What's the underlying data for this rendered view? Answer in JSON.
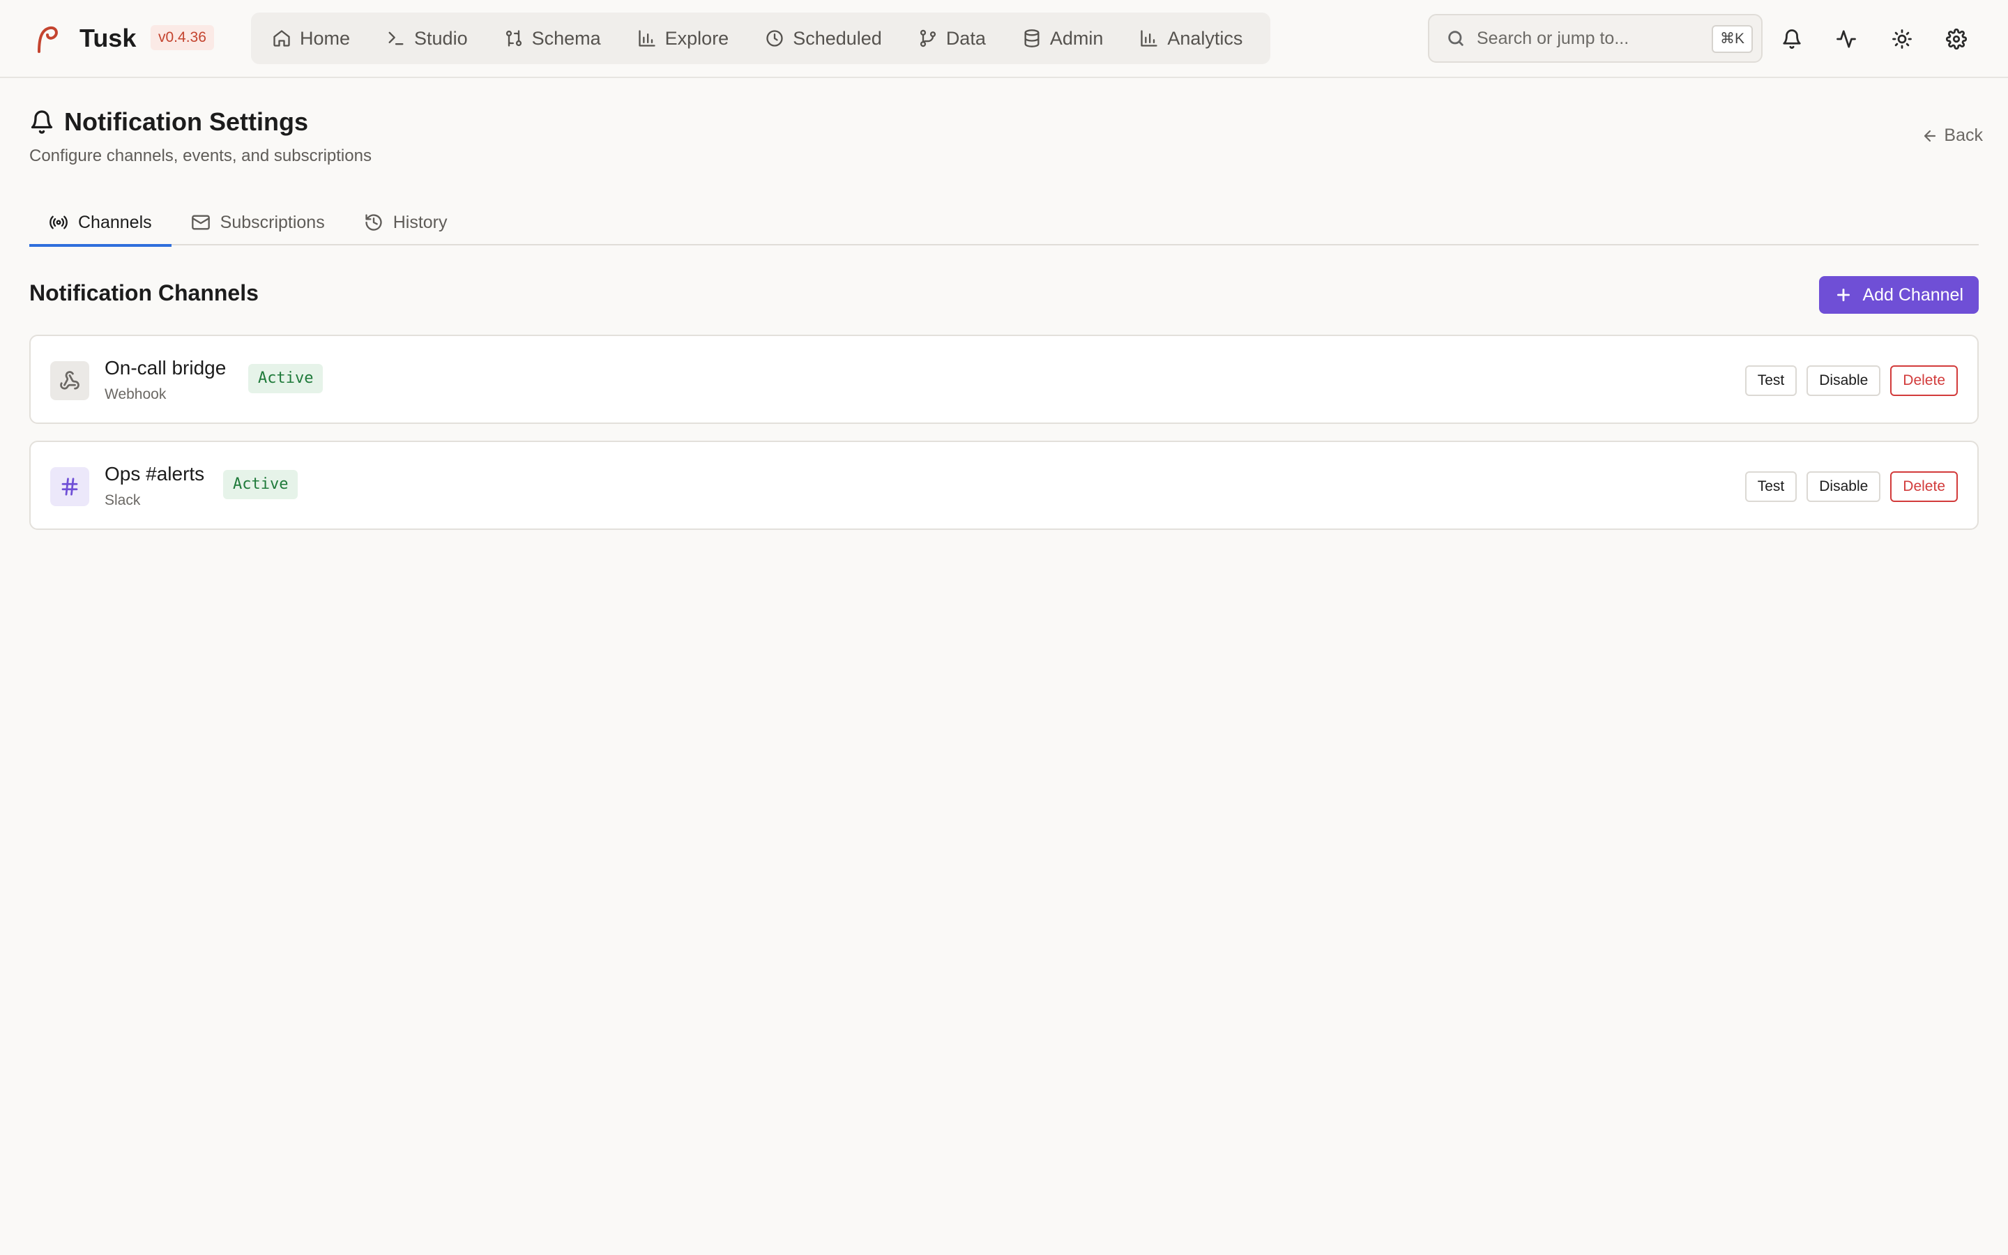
{
  "app": {
    "name": "Tusk",
    "version": "v0.4.36"
  },
  "nav": [
    {
      "label": "Home",
      "icon": "home-icon"
    },
    {
      "label": "Studio",
      "icon": "terminal-icon"
    },
    {
      "label": "Schema",
      "icon": "git-compare-icon"
    },
    {
      "label": "Explore",
      "icon": "bar-chart-icon"
    },
    {
      "label": "Scheduled",
      "icon": "clock-icon"
    },
    {
      "label": "Data",
      "icon": "git-branch-icon"
    },
    {
      "label": "Admin",
      "icon": "database-icon"
    },
    {
      "label": "Analytics",
      "icon": "bar-chart-icon"
    }
  ],
  "search": {
    "placeholder": "Search or jump to...",
    "shortcut": "⌘K"
  },
  "page": {
    "title": "Notification Settings",
    "subtitle": "Configure channels, events, and subscriptions",
    "back_label": "Back"
  },
  "tabs": [
    {
      "label": "Channels",
      "active": true
    },
    {
      "label": "Subscriptions",
      "active": false
    },
    {
      "label": "History",
      "active": false
    }
  ],
  "section": {
    "title": "Notification Channels",
    "add_label": "Add Channel"
  },
  "channels": [
    {
      "name": "On-call bridge",
      "type": "Webhook",
      "status": "Active",
      "icon": "webhook-icon"
    },
    {
      "name": "Ops #alerts",
      "type": "Slack",
      "status": "Active",
      "icon": "hash-icon"
    }
  ],
  "actions": {
    "test": "Test",
    "disable": "Disable",
    "delete": "Delete"
  },
  "colors": {
    "accent": "#6f4fd6",
    "tab_underline": "#2f6fdc",
    "active_badge": "#1f7a3a",
    "danger": "#d23b3b",
    "version_badge": "#c4442f"
  }
}
